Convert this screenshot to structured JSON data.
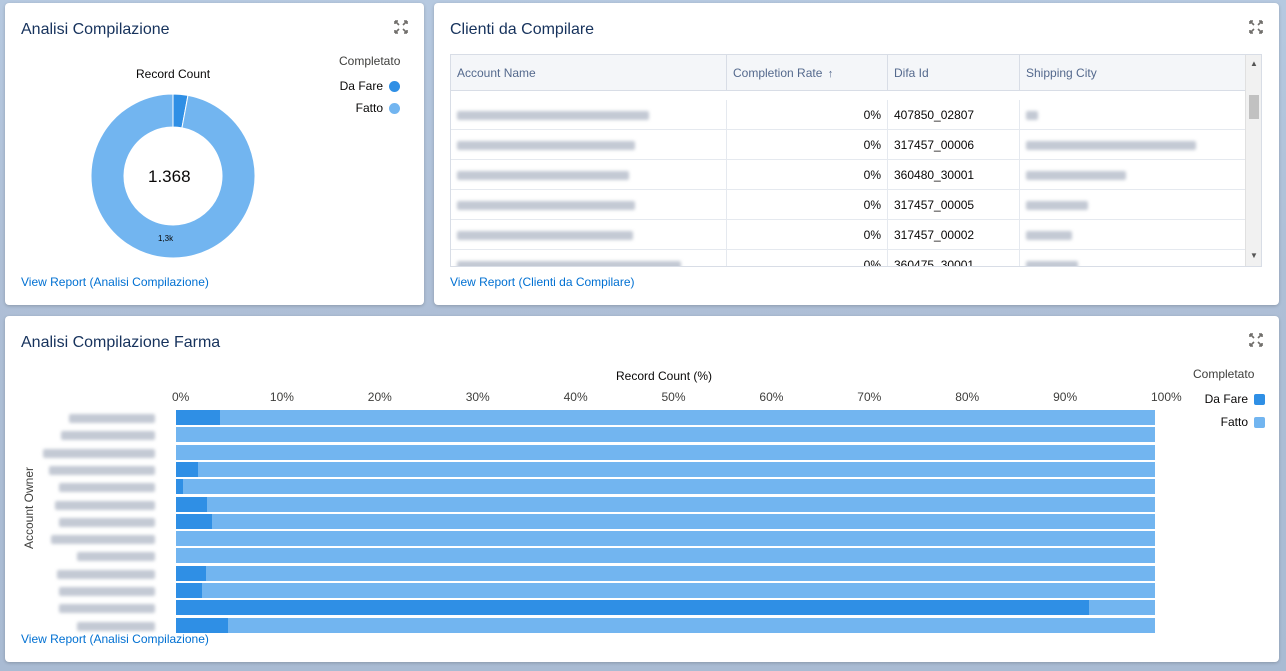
{
  "colors": {
    "da_fare": "#2f8fe5",
    "fatto": "#72b5f0",
    "link": "#0070d2"
  },
  "card1": {
    "title": "Analisi Compilazione",
    "chart_title": "Record Count",
    "center_value": "1.368",
    "slice_label": "1,3k",
    "legend_title": "Completato",
    "legend": [
      "Da Fare",
      "Fatto"
    ],
    "view_report": "View Report (Analisi Compilazione)",
    "expand_icon": "expand-icon"
  },
  "card2": {
    "title": "Clienti da Compilare",
    "columns": [
      "Account Name",
      "Completion Rate",
      "Difa Id",
      "Shipping City"
    ],
    "sort_icon": "arrow-up-icon",
    "rows": [
      {
        "rate": "0%",
        "difa_id": "407850_02807"
      },
      {
        "rate": "0%",
        "difa_id": "317457_00006"
      },
      {
        "rate": "0%",
        "difa_id": "360480_30001"
      },
      {
        "rate": "0%",
        "difa_id": "317457_00005"
      },
      {
        "rate": "0%",
        "difa_id": "317457_00002"
      },
      {
        "rate": "0%",
        "difa_id": "360475_30001"
      }
    ],
    "view_report": "View Report (Clienti da Compilare)"
  },
  "card3": {
    "title": "Analisi Compilazione Farma",
    "view_report": "View Report (Analisi Compilazione)",
    "legend_title": "Completato",
    "legend": [
      "Da Fare",
      "Fatto"
    ]
  },
  "chart_data": [
    {
      "type": "pie",
      "title": "Record Count",
      "categories": [
        "Da Fare",
        "Fatto"
      ],
      "values": [
        40,
        1328
      ],
      "total": "1.368",
      "legend_title": "Completato"
    },
    {
      "type": "bar",
      "orientation": "horizontal",
      "stacked": true,
      "title": "Record Count (%)",
      "ylabel": "Account Owner",
      "xlim": [
        0,
        100
      ],
      "ticks": [
        "0%",
        "10%",
        "20%",
        "30%",
        "40%",
        "50%",
        "60%",
        "70%",
        "80%",
        "90%",
        "100%"
      ],
      "legend_title": "Completato",
      "series": [
        {
          "name": "Da Fare",
          "values": [
            4.5,
            0,
            0,
            2.2,
            0.7,
            3.2,
            3.7,
            0,
            0,
            3.1,
            2.7,
            93.3,
            5.3
          ]
        },
        {
          "name": "Fatto",
          "values": [
            95.5,
            100,
            100,
            97.8,
            99.3,
            96.8,
            96.3,
            100,
            100,
            96.9,
            97.3,
            6.7,
            94.7
          ]
        }
      ]
    }
  ]
}
